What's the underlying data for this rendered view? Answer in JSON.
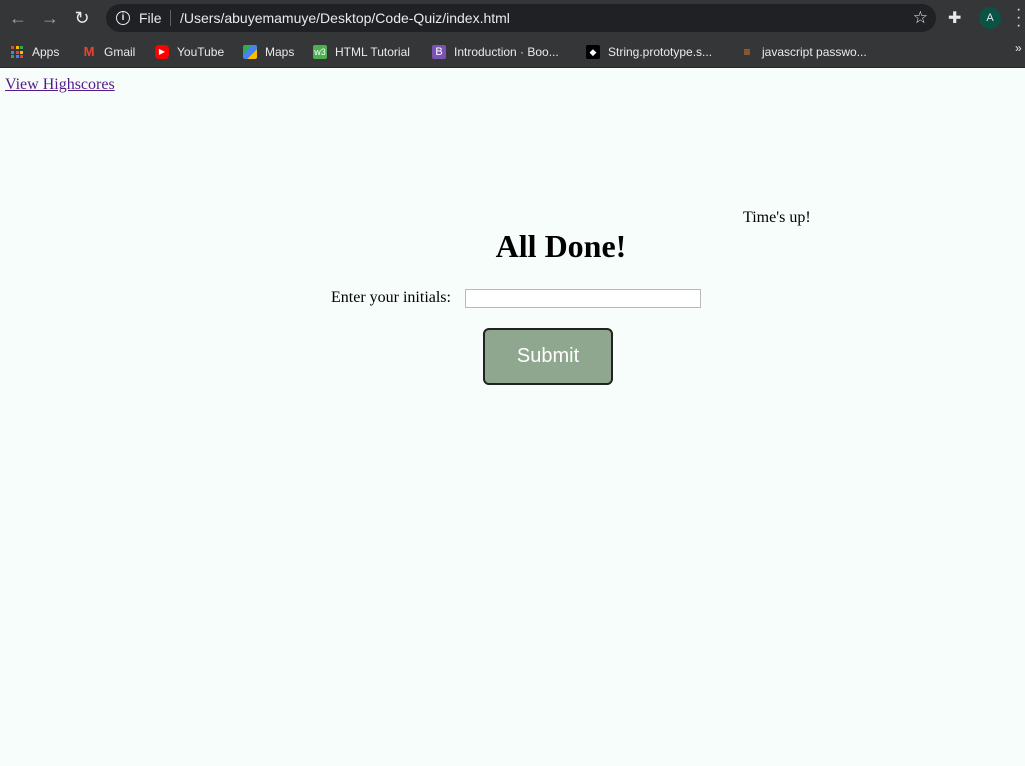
{
  "browser": {
    "url_scheme": "File",
    "url": "/Users/abuyemamuye/Desktop/Code-Quiz/index.html",
    "profile_initial": "A",
    "bookmarks": [
      {
        "label": "Apps",
        "icon": "apps-grid-icon"
      },
      {
        "label": "Gmail",
        "icon": "gmail-icon"
      },
      {
        "label": "YouTube",
        "icon": "youtube-icon"
      },
      {
        "label": "Maps",
        "icon": "maps-icon"
      },
      {
        "label": "HTML Tutorial",
        "icon": "w3schools-icon"
      },
      {
        "label": "Introduction · Boo...",
        "icon": "bootstrap-icon"
      },
      {
        "label": "String.prototype.s...",
        "icon": "mdn-icon"
      },
      {
        "label": "javascript passwo...",
        "icon": "stackoverflow-icon"
      }
    ],
    "overflow_label": "»"
  },
  "page": {
    "highscores_link": "View Highscores",
    "timer_text": "Time's up!",
    "title": "All Done!",
    "initials_label": "Enter your initials:",
    "initials_value": "",
    "submit_label": "Submit"
  },
  "colors": {
    "page_background": "#f7fdfa",
    "submit_button": "#8fa68f",
    "chrome_toolbar": "#353638"
  }
}
